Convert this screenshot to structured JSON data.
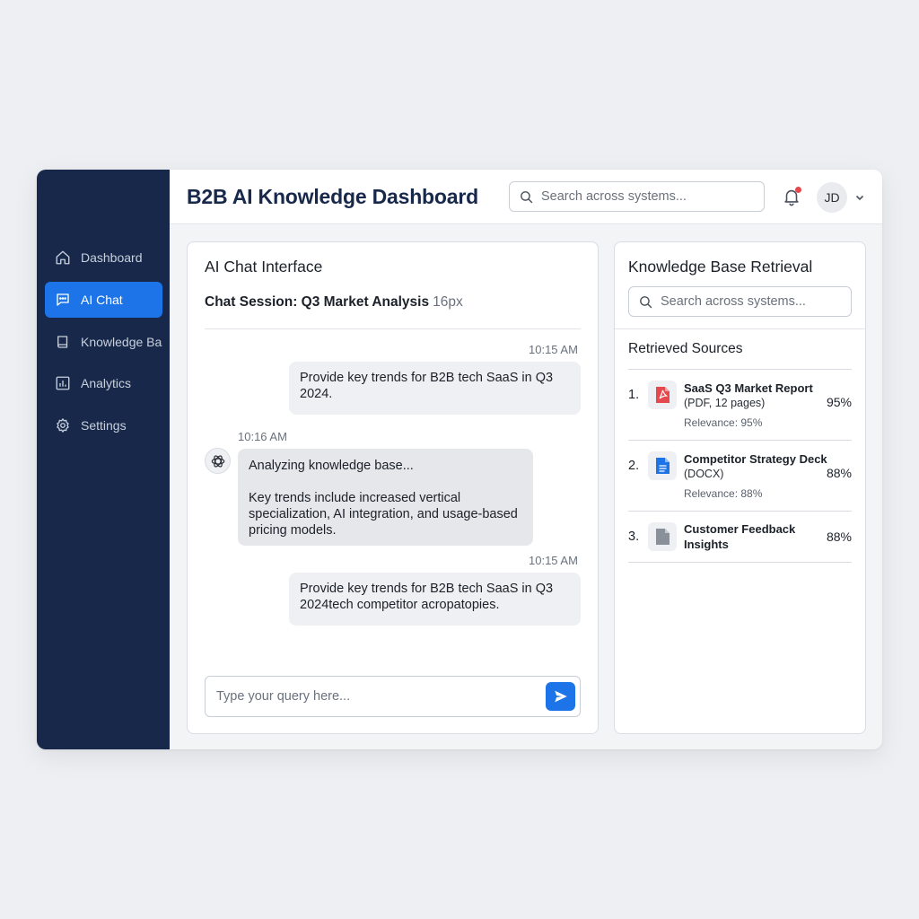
{
  "app": {
    "title": "B2B AI Knowledge Dashboard"
  },
  "colors": {
    "sidebar": "#17284a",
    "accent": "#1d74e8",
    "notification": "#e5484d",
    "pdf": "#e5484d",
    "docx": "#1d74e8"
  },
  "sidebar": {
    "items": [
      {
        "label": "Dashboard",
        "icon": "home-icon",
        "active": false
      },
      {
        "label": "AI Chat",
        "icon": "chat-icon",
        "active": true
      },
      {
        "label": "Knowledge Base",
        "icon": "book-icon",
        "active": false
      },
      {
        "label": "Analytics",
        "icon": "chart-icon",
        "active": false
      },
      {
        "label": "Settings",
        "icon": "gear-icon",
        "active": false
      }
    ]
  },
  "header": {
    "search_placeholder": "Search across systems...",
    "avatar_initials": "JD",
    "has_notification": true
  },
  "chat": {
    "panel_title": "AI Chat Interface",
    "session_label": "Chat Session: Q3 Market Analysis",
    "session_size": "16px",
    "messages": [
      {
        "role": "user",
        "time": "10:15 AM",
        "text": "Provide key trends for B2B tech SaaS in Q3 2024."
      },
      {
        "role": "assistant",
        "time": "10:16 AM",
        "status": "Analyzing knowledge base...",
        "text": "Key trends include increased vertical specialization, AI integration, and usage-based pricing models."
      },
      {
        "role": "user",
        "time": "10:15 AM",
        "text": "Provide key trends for B2B tech SaaS in Q3 2024tech competitor acropatopies."
      }
    ],
    "input_placeholder": "Type your query here..."
  },
  "knowledge_base": {
    "panel_title": "Knowledge Base Retrieval",
    "search_placeholder": "Search across systems...",
    "sources_heading": "Retrieved Sources",
    "sources": [
      {
        "num": "1.",
        "title": "SaaS Q3 Market Report",
        "meta": "(PDF, 12 pages)",
        "relevance": "Relevance: 95%",
        "score": "95%",
        "icon": "pdf-icon"
      },
      {
        "num": "2.",
        "title": "Competitor Strategy Deck",
        "meta": "(DOCX)",
        "relevance": "Relevance: 88%",
        "score": "88%",
        "icon": "doc-icon"
      },
      {
        "num": "3.",
        "title": "Customer Feedback",
        "title2": "Insights",
        "score": "88%",
        "icon": "file-icon"
      }
    ]
  }
}
